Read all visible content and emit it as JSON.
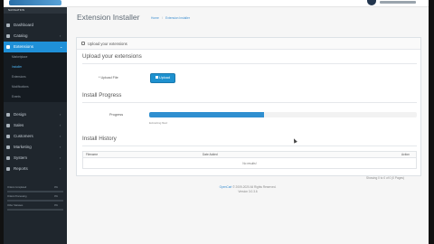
{
  "header": {
    "logo_text": "opencart"
  },
  "sidebar": {
    "header": "NAVIGATION",
    "items": [
      {
        "label": "Dashboard",
        "icon": "dashboard-icon"
      },
      {
        "label": "Catalog",
        "icon": "tag-icon"
      },
      {
        "label": "Extensions",
        "icon": "puzzle-icon"
      },
      {
        "label": "Design",
        "icon": "monitor-icon"
      },
      {
        "label": "Sales",
        "icon": "cart-icon"
      },
      {
        "label": "Customers",
        "icon": "user-icon"
      },
      {
        "label": "Marketing",
        "icon": "share-icon"
      },
      {
        "label": "System",
        "icon": "gear-icon"
      },
      {
        "label": "Reports",
        "icon": "bar-chart-icon"
      }
    ],
    "sub_items": [
      {
        "label": "Marketplace"
      },
      {
        "label": "Installer"
      },
      {
        "label": "Extensions"
      },
      {
        "label": "Modifications"
      },
      {
        "label": "Events"
      }
    ],
    "stats": [
      {
        "label": "Orders Completed",
        "value": "0%",
        "fraction": 0
      },
      {
        "label": "Orders Processing",
        "value": "0%",
        "fraction": 0
      },
      {
        "label": "Other Statuses",
        "value": "0%",
        "fraction": 0
      }
    ]
  },
  "page": {
    "title": "Extension Installer",
    "breadcrumb": [
      "Home",
      "Extension Installer"
    ]
  },
  "panel": {
    "heading": "Upload your extensions",
    "upload_section_title": "Upload your extensions",
    "upload_label": "* Upload File",
    "upload_button": "Upload",
    "progress_section_title": "Install Progress",
    "progress_label": "Progress",
    "progress_fraction": 0.43,
    "progress_status": "Extracting files!",
    "history_section_title": "Install History",
    "table": {
      "columns": [
        "Filename",
        "Date Added",
        "Action"
      ],
      "empty_text": "No results!"
    },
    "pagination_text": "Showing 0 to 0 of 0 (0 Pages)"
  },
  "footer": {
    "brand": "OpenCart",
    "copyright": "© 2009-2020 All Rights Reserved.",
    "version": "Version 3.0.3.6"
  },
  "colors": {
    "accent": "#1e91cf",
    "sidebar_bg": "#1f262d",
    "progress": "#2f8fd0"
  }
}
